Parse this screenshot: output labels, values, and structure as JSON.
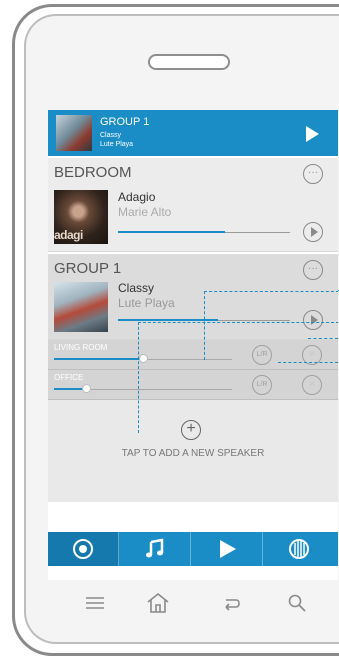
{
  "now_playing": {
    "title": "GROUP 1",
    "line1": "Classy",
    "line2": "Lute Playa"
  },
  "rooms": [
    {
      "name": "BEDROOM",
      "track": "Adagio",
      "artist": "Marie Alto",
      "art_text": "adagi",
      "progress": 0.62
    },
    {
      "name": "GROUP 1",
      "track": "Classy",
      "artist": "Lute Playa",
      "progress": 0.58
    }
  ],
  "group_speakers": [
    {
      "name": "LIVING ROOM",
      "lr_label": "L",
      "volume": 0.5
    },
    {
      "name": "OFFICE",
      "lr_label": "L",
      "volume": 0.18
    }
  ],
  "add_speaker": {
    "label": "TAP TO ADD A NEW SPEAKER"
  },
  "tabs": [
    {
      "name": "speakers",
      "icon": "speaker-icon",
      "selected": true
    },
    {
      "name": "music",
      "icon": "music-note-icon",
      "selected": false
    },
    {
      "name": "now-playing",
      "icon": "play-icon",
      "selected": false
    },
    {
      "name": "settings",
      "icon": "equalizer-icon",
      "selected": false
    }
  ],
  "system_nav": [
    "menu-icon",
    "home-icon",
    "back-icon",
    "search-icon"
  ],
  "colors": {
    "accent": "#1a8dc6",
    "room_bg": "#dcdcdc"
  }
}
